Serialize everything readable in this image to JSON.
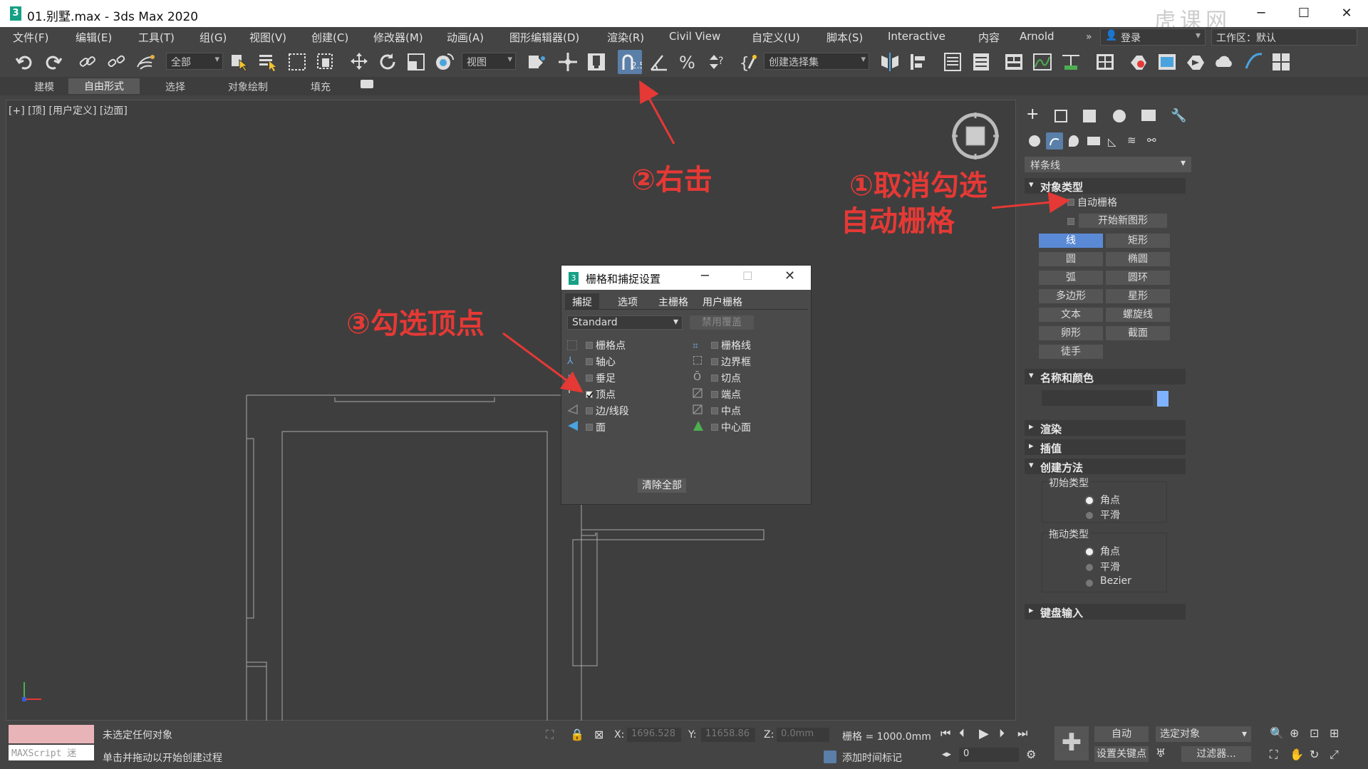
{
  "window": {
    "title": "01.别墅.max - 3ds Max 2020",
    "icon_letter": "3"
  },
  "menu": [
    "文件(F)",
    "编辑(E)",
    "工具(T)",
    "组(G)",
    "视图(V)",
    "创建(C)",
    "修改器(M)",
    "动画(A)",
    "图形编辑器(D)",
    "渲染(R)",
    "Civil View",
    "自定义(U)",
    "脚本(S)",
    "Interactive",
    "内容",
    "Arnold"
  ],
  "login_label": "登录",
  "workspace_label": "工作区：默认",
  "toolbar": {
    "selection_filter": "全部",
    "ref_coord": "视图",
    "named_selection": "创建选择集"
  },
  "ribbon_tabs": [
    "建模",
    "自由形式",
    "选择",
    "对象绘制",
    "填充"
  ],
  "viewport_label": "[+] [顶] [用户定义] [边面]",
  "command_panel": {
    "category": "样条线",
    "object_type": {
      "title": "对象类型",
      "autogrid": "自动栅格",
      "start_new_shape": "开始新图形",
      "shapes": [
        "线",
        "矩形",
        "圆",
        "椭圆",
        "弧",
        "圆环",
        "多边形",
        "星形",
        "文本",
        "螺旋线",
        "卵形",
        "截面",
        "徒手"
      ]
    },
    "name_color": {
      "title": "名称和颜色",
      "swatch": "#7fb3ff"
    },
    "rendering": "渲染",
    "interpolation": "插值",
    "creation_method": {
      "title": "创建方法",
      "initial_type": "初始类型",
      "initial_options": [
        "角点",
        "平滑"
      ],
      "drag_type": "拖动类型",
      "drag_options": [
        "角点",
        "平滑",
        "Bezier"
      ]
    },
    "keyboard_entry": "键盘输入"
  },
  "dialog": {
    "title": "栅格和捕捉设置",
    "tabs": [
      "捕捉",
      "选项",
      "主栅格",
      "用户栅格"
    ],
    "preset": "Standard",
    "override_button": "禁用覆盖",
    "snaps_left": [
      {
        "label": "栅格点",
        "checked": false
      },
      {
        "label": "轴心",
        "checked": false
      },
      {
        "label": "垂足",
        "checked": false
      },
      {
        "label": "顶点",
        "checked": true
      },
      {
        "label": "边/线段",
        "checked": false
      },
      {
        "label": "面",
        "checked": false
      }
    ],
    "snaps_right": [
      {
        "label": "栅格线",
        "checked": false
      },
      {
        "label": "边界框",
        "checked": false
      },
      {
        "label": "切点",
        "checked": false
      },
      {
        "label": "端点",
        "checked": false
      },
      {
        "label": "中点",
        "checked": false
      },
      {
        "label": "中心面",
        "checked": false
      }
    ],
    "clear_all": "清除全部"
  },
  "annotations": {
    "step1_line1": "①取消勾选",
    "step1_line2": "自动栅格",
    "step2": "②右击",
    "step3": "③勾选顶点",
    "color": "#e53935"
  },
  "status": {
    "maxscript": "MAXScript 迷",
    "selection": "未选定任何对象",
    "prompt": "单击并拖动以开始创建过程",
    "x_label": "X:",
    "x_value": "1696.528",
    "y_label": "Y:",
    "y_value": "11658.86",
    "z_label": "Z:",
    "z_value": "0.0mm",
    "grid": "栅格 = 1000.0mm",
    "add_time_tag": "添加时间标记",
    "auto": "自动",
    "selected_object": "选定对象",
    "set_key": "设置关键点",
    "filters": "过滤器...",
    "frame": "0"
  },
  "watermark": "虎课网"
}
